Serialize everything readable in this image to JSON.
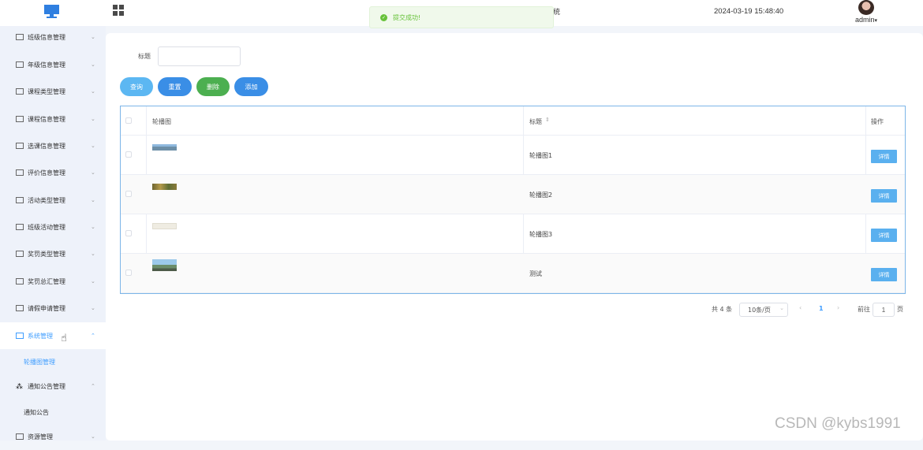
{
  "header": {
    "system_title": "统",
    "datetime": "2024-03-19 15:48:40",
    "user_name": "admin",
    "user_chevron": "▾"
  },
  "toast": {
    "message": "提交成功!",
    "color": "#67c23a"
  },
  "sidebar": {
    "items": [
      {
        "label": "班级信息管理",
        "chevron": "⌄"
      },
      {
        "label": "年级信息管理",
        "chevron": "⌄"
      },
      {
        "label": "课程类型管理",
        "chevron": "⌄"
      },
      {
        "label": "课程信息管理",
        "chevron": "⌄"
      },
      {
        "label": "选课信息管理",
        "chevron": "⌄"
      },
      {
        "label": "评价信息管理",
        "chevron": "⌄"
      },
      {
        "label": "活动类型管理",
        "chevron": "⌄"
      },
      {
        "label": "班级活动管理",
        "chevron": "⌄"
      },
      {
        "label": "奖罚类型管理",
        "chevron": "⌄"
      },
      {
        "label": "奖罚总汇管理",
        "chevron": "⌄"
      },
      {
        "label": "请假申请管理",
        "chevron": "⌄"
      },
      {
        "label": "系统管理",
        "chevron": "⌃"
      },
      {
        "label": "轮播图管理"
      },
      {
        "label": "通知公告管理",
        "chevron": "⌃"
      },
      {
        "label": "通知公告"
      },
      {
        "label": "资源管理",
        "chevron": "⌄"
      }
    ],
    "accent": "#409eff"
  },
  "search": {
    "label": "标题",
    "value": "",
    "placeholder": ""
  },
  "buttons": {
    "query": {
      "label": "查询",
      "color": "#5cb7f2"
    },
    "reset": {
      "label": "重置",
      "color": "#3a8ee6"
    },
    "delete": {
      "label": "删除",
      "color": "#4caf50"
    },
    "add": {
      "label": "添加",
      "color": "#3a8ee6"
    }
  },
  "table": {
    "headers": {
      "image": "轮播图",
      "title": "标题",
      "sort_icon": "⇕",
      "actions": "操作"
    },
    "rows": [
      {
        "title": "轮播图1",
        "action": "详情"
      },
      {
        "title": "轮播图2",
        "action": "详情"
      },
      {
        "title": "轮播图3",
        "action": "详情"
      },
      {
        "title": "测试",
        "action": "详情"
      }
    ]
  },
  "pagination": {
    "total": "共 4 条",
    "page_size": "10条/页",
    "prev": "‹",
    "current": "1",
    "next": "›",
    "goto_label": "前往",
    "goto_value": "1",
    "goto_suffix": "页"
  },
  "watermark": "CSDN @kybs1991"
}
